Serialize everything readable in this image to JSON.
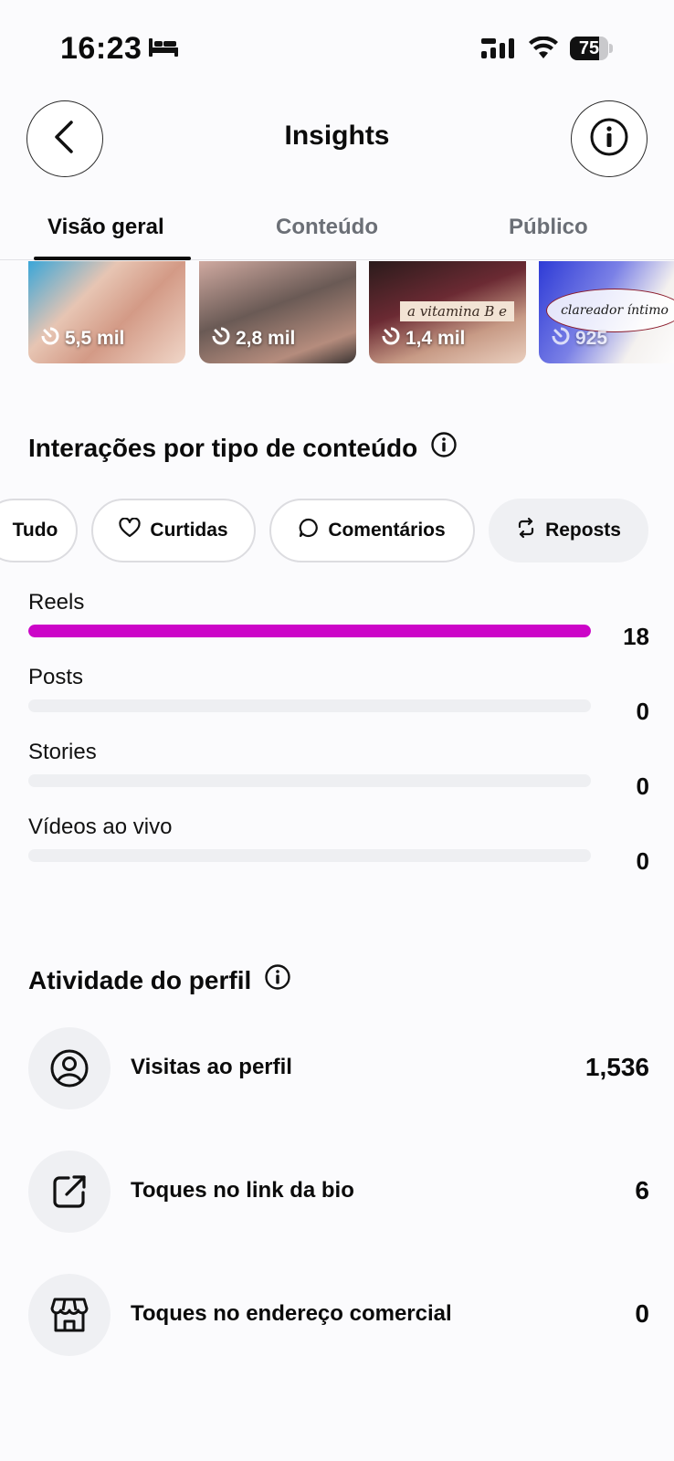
{
  "status_bar": {
    "time": "16:23",
    "battery_level": 75,
    "battery_label": "75",
    "icons": [
      "bed-icon",
      "cellular-signal-icon",
      "wifi-icon",
      "battery-icon"
    ]
  },
  "header": {
    "title": "Insights",
    "back_icon": "chevron-left-icon",
    "info_icon": "info-icon"
  },
  "tabs": [
    {
      "label": "Visão geral",
      "active": true
    },
    {
      "label": "Conteúdo",
      "active": false
    },
    {
      "label": "Público",
      "active": false
    }
  ],
  "thumbnails": [
    {
      "views": "5,5 mil"
    },
    {
      "views": "2,8 mil"
    },
    {
      "views": "1,4 mil",
      "caption": "a vitamina B e"
    },
    {
      "views": "925",
      "caption": "clareador íntimo"
    }
  ],
  "interactions": {
    "title": "Interações por tipo de conteúdo",
    "filters": [
      {
        "label": "Tudo",
        "icon": null,
        "selected": false
      },
      {
        "label": "Curtidas",
        "icon": "heart-icon",
        "selected": false
      },
      {
        "label": "Comentários",
        "icon": "comment-icon",
        "selected": false
      },
      {
        "label": "Reposts",
        "icon": "repost-icon",
        "selected": true
      }
    ],
    "metrics": [
      {
        "label": "Reels",
        "value": "18",
        "fraction": 1.0
      },
      {
        "label": "Posts",
        "value": "0",
        "fraction": 0
      },
      {
        "label": "Stories",
        "value": "0",
        "fraction": 0
      },
      {
        "label": "Vídeos ao vivo",
        "value": "0",
        "fraction": 0
      }
    ],
    "accent_color": "#cc05c8"
  },
  "profile_activity": {
    "title": "Atividade do perfil",
    "rows": [
      {
        "label": "Visitas ao perfil",
        "value": "1,536",
        "icon": "profile-icon"
      },
      {
        "label": "Toques no link da bio",
        "value": "6",
        "icon": "external-link-icon"
      },
      {
        "label": "Toques no endereço comercial",
        "value": "0",
        "icon": "storefront-icon"
      }
    ]
  }
}
